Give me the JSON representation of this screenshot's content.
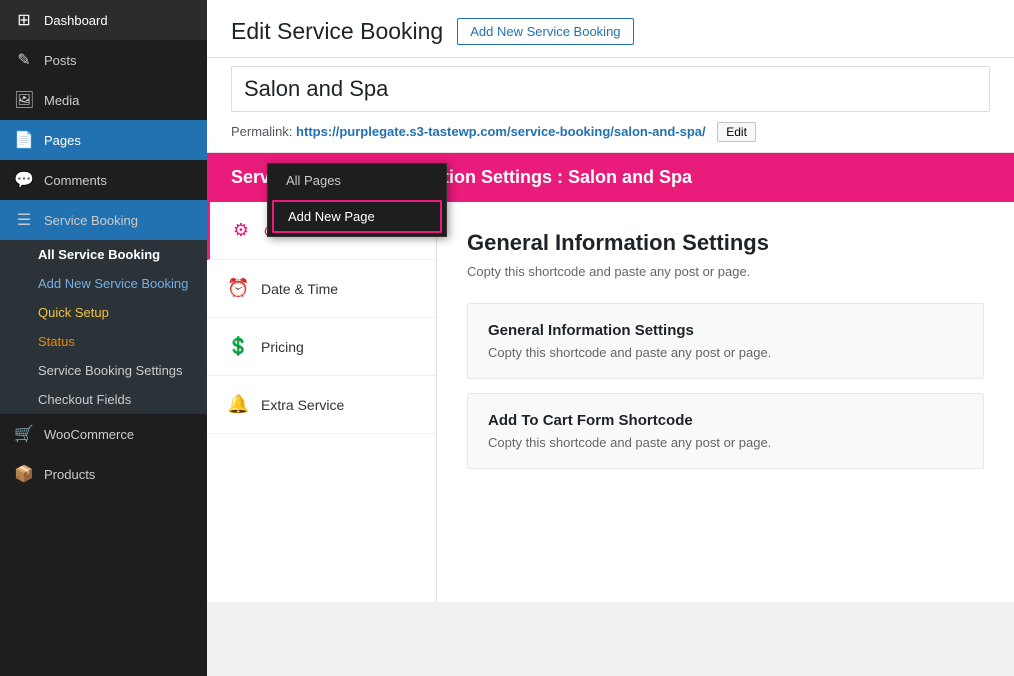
{
  "sidebar": {
    "items": [
      {
        "id": "dashboard",
        "label": "Dashboard",
        "icon": "⊞",
        "active": false
      },
      {
        "id": "posts",
        "label": "Posts",
        "icon": "📝",
        "active": false
      },
      {
        "id": "media",
        "label": "Media",
        "icon": "🖼",
        "active": false
      },
      {
        "id": "pages",
        "label": "Pages",
        "icon": "📄",
        "active": true
      },
      {
        "id": "comments",
        "label": "Comments",
        "icon": "💬",
        "active": false
      },
      {
        "id": "service-booking",
        "label": "Service Booking",
        "icon": "📋",
        "active": false
      },
      {
        "id": "woocommerce",
        "label": "WooCommerce",
        "icon": "🛒",
        "active": false
      },
      {
        "id": "products",
        "label": "Products",
        "icon": "📦",
        "active": false
      }
    ],
    "pages_submenu": {
      "all_pages": "All Pages",
      "add_new_page": "Add New Page"
    },
    "service_submenu": {
      "all_service": "All Service Booking",
      "add_new": "Add New Service Booking",
      "quick_setup": "Quick Setup",
      "status": "Status",
      "settings": "Service Booking Settings",
      "checkout": "Checkout Fields"
    }
  },
  "main": {
    "title": "Edit Service Booking",
    "add_new_label": "Add New Service Booking",
    "permalink_label": "Permalink:",
    "permalink_url": "https://purplegate.s3-tastewp.com/service-booking/salon-and-spa/",
    "edit_label": "Edit",
    "title_input_value": "Salon and Spa",
    "banner_text": "Service Booking Information Settings : Salon and Spa",
    "tabs": [
      {
        "id": "general",
        "label": "General Info",
        "icon": "⚙",
        "active": true
      },
      {
        "id": "datetime",
        "label": "Date & Time",
        "icon": "🕐",
        "active": false
      },
      {
        "id": "pricing",
        "label": "Pricing",
        "icon": "💲",
        "active": false
      },
      {
        "id": "extra",
        "label": "Extra Service",
        "icon": "🔔",
        "active": false
      }
    ],
    "tab_content": {
      "heading": "General Information Settings",
      "subtitle": "Copty this shortcode and paste any post or page.",
      "cards": [
        {
          "title": "General Information Settings",
          "description": "Copty this shortcode and paste any post or page."
        },
        {
          "title": "Add To Cart Form Shortcode",
          "description": "Copty this shortcode and paste any post or page."
        }
      ]
    }
  },
  "dropdown": {
    "all_pages": "All Pages",
    "add_new_page": "Add New Page"
  },
  "colors": {
    "accent": "#e91b7b",
    "link": "#2271b1",
    "sidebar_bg": "#1e1e1e",
    "active_bg": "#2271b1"
  }
}
